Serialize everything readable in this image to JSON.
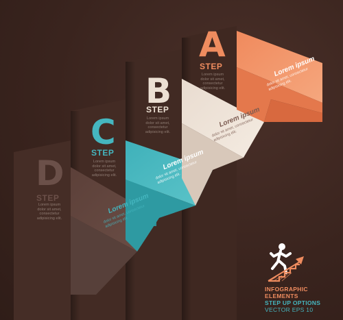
{
  "steps": [
    {
      "letter": "A",
      "label": "STEP",
      "color": "#ef8c5f",
      "body": [
        "Lorem ipsum",
        "dolor sit amet,",
        "consectetur",
        "adipisicing elit."
      ]
    },
    {
      "letter": "B",
      "label": "STEP",
      "color": "#ece0d3",
      "body": [
        "Lorem ipsum",
        "dolor sit amet,",
        "consectetur",
        "adipisicing elit."
      ]
    },
    {
      "letter": "C",
      "label": "STEP",
      "color": "#45b6bf",
      "body": [
        "Lorem ipsum",
        "dolor sit amet,",
        "consectetur",
        "adipisicing elit."
      ]
    },
    {
      "letter": "D",
      "label": "STEP",
      "color": "#6b5049",
      "body": [
        "Lorem ipsum",
        "dolor sit amet,",
        "consectetur",
        "adipisicing elit."
      ]
    }
  ],
  "ribbons": [
    {
      "title": "Lorem ipsum",
      "sub": [
        "dolor sit amet, consectetur",
        "adipisicing elit."
      ],
      "color": "#ef8c5f"
    },
    {
      "title": "Lorem ipsum",
      "sub": [
        "dolor sit amet, consectetur",
        "adipisicing elit."
      ],
      "color": "#ece0d3"
    },
    {
      "title": "Lorem ipsum",
      "sub": [
        "dolor sit amet, consectetur",
        "adipisicing elit."
      ],
      "color": "#45b6bf"
    },
    {
      "title": "Lorem ipsum",
      "sub": [
        "dolor sit amet, consectetur",
        "adipisicing elit."
      ],
      "color": "#5c4039"
    }
  ],
  "footer": {
    "line1": "INFOGRAPHIC",
    "line2": "ELEMENTS",
    "line3": "STEP UP OPTIONS",
    "line4": "VECTOR EPS 10"
  },
  "icon": "runner-stairs-icon",
  "background_color": "#3b2620"
}
